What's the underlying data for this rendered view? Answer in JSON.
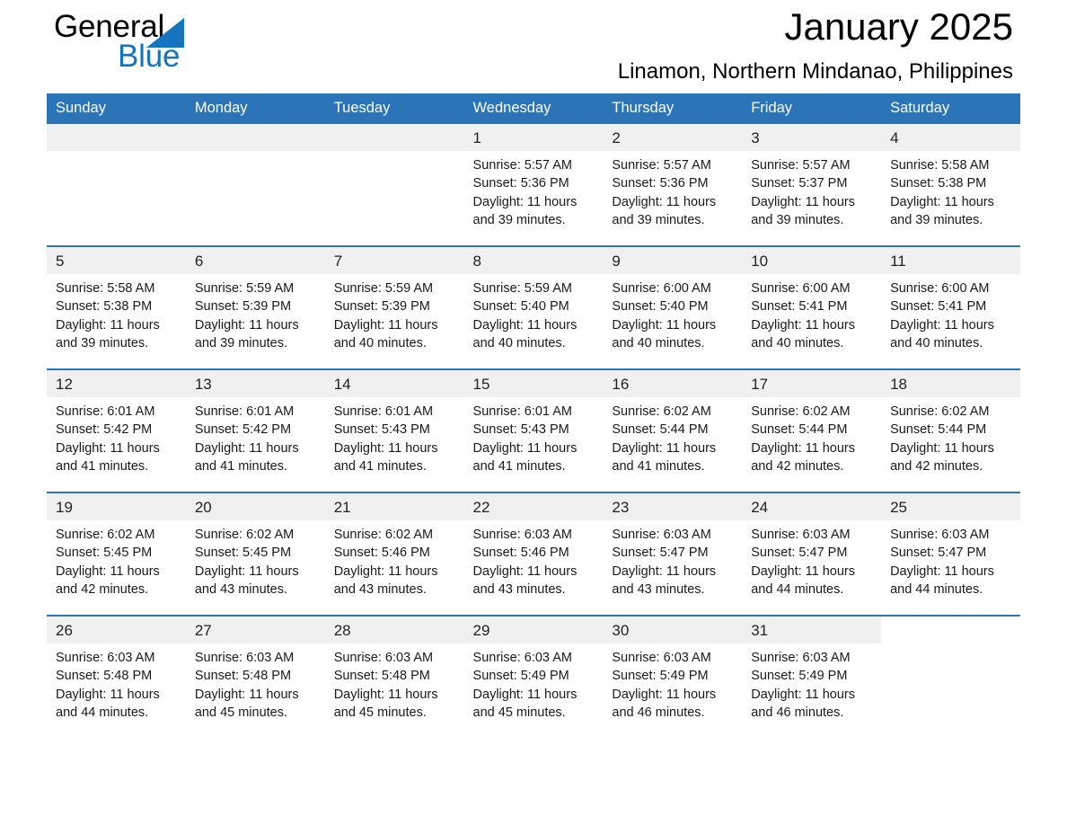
{
  "brand": {
    "word_one": "General",
    "word_two": "Blue",
    "accent_color": "#1574bd"
  },
  "header": {
    "title": "January 2025",
    "location": "Linamon, Northern Mindanao, Philippines",
    "header_bg": "#2b74b8",
    "daynum_bg": "#f0f0f0"
  },
  "weekday_headers": [
    "Sunday",
    "Monday",
    "Tuesday",
    "Wednesday",
    "Thursday",
    "Friday",
    "Saturday"
  ],
  "weeks": [
    [
      {
        "day": "",
        "sunrise": "",
        "sunset": "",
        "daylight_1": "",
        "daylight_2": "",
        "blank": true
      },
      {
        "day": "",
        "sunrise": "",
        "sunset": "",
        "daylight_1": "",
        "daylight_2": "",
        "blank": true
      },
      {
        "day": "",
        "sunrise": "",
        "sunset": "",
        "daylight_1": "",
        "daylight_2": "",
        "blank": true
      },
      {
        "day": "1",
        "sunrise": "Sunrise: 5:57 AM",
        "sunset": "Sunset: 5:36 PM",
        "daylight_1": "Daylight: 11 hours",
        "daylight_2": "and 39 minutes."
      },
      {
        "day": "2",
        "sunrise": "Sunrise: 5:57 AM",
        "sunset": "Sunset: 5:36 PM",
        "daylight_1": "Daylight: 11 hours",
        "daylight_2": "and 39 minutes."
      },
      {
        "day": "3",
        "sunrise": "Sunrise: 5:57 AM",
        "sunset": "Sunset: 5:37 PM",
        "daylight_1": "Daylight: 11 hours",
        "daylight_2": "and 39 minutes."
      },
      {
        "day": "4",
        "sunrise": "Sunrise: 5:58 AM",
        "sunset": "Sunset: 5:38 PM",
        "daylight_1": "Daylight: 11 hours",
        "daylight_2": "and 39 minutes."
      }
    ],
    [
      {
        "day": "5",
        "sunrise": "Sunrise: 5:58 AM",
        "sunset": "Sunset: 5:38 PM",
        "daylight_1": "Daylight: 11 hours",
        "daylight_2": "and 39 minutes."
      },
      {
        "day": "6",
        "sunrise": "Sunrise: 5:59 AM",
        "sunset": "Sunset: 5:39 PM",
        "daylight_1": "Daylight: 11 hours",
        "daylight_2": "and 39 minutes."
      },
      {
        "day": "7",
        "sunrise": "Sunrise: 5:59 AM",
        "sunset": "Sunset: 5:39 PM",
        "daylight_1": "Daylight: 11 hours",
        "daylight_2": "and 40 minutes."
      },
      {
        "day": "8",
        "sunrise": "Sunrise: 5:59 AM",
        "sunset": "Sunset: 5:40 PM",
        "daylight_1": "Daylight: 11 hours",
        "daylight_2": "and 40 minutes."
      },
      {
        "day": "9",
        "sunrise": "Sunrise: 6:00 AM",
        "sunset": "Sunset: 5:40 PM",
        "daylight_1": "Daylight: 11 hours",
        "daylight_2": "and 40 minutes."
      },
      {
        "day": "10",
        "sunrise": "Sunrise: 6:00 AM",
        "sunset": "Sunset: 5:41 PM",
        "daylight_1": "Daylight: 11 hours",
        "daylight_2": "and 40 minutes."
      },
      {
        "day": "11",
        "sunrise": "Sunrise: 6:00 AM",
        "sunset": "Sunset: 5:41 PM",
        "daylight_1": "Daylight: 11 hours",
        "daylight_2": "and 40 minutes."
      }
    ],
    [
      {
        "day": "12",
        "sunrise": "Sunrise: 6:01 AM",
        "sunset": "Sunset: 5:42 PM",
        "daylight_1": "Daylight: 11 hours",
        "daylight_2": "and 41 minutes."
      },
      {
        "day": "13",
        "sunrise": "Sunrise: 6:01 AM",
        "sunset": "Sunset: 5:42 PM",
        "daylight_1": "Daylight: 11 hours",
        "daylight_2": "and 41 minutes."
      },
      {
        "day": "14",
        "sunrise": "Sunrise: 6:01 AM",
        "sunset": "Sunset: 5:43 PM",
        "daylight_1": "Daylight: 11 hours",
        "daylight_2": "and 41 minutes."
      },
      {
        "day": "15",
        "sunrise": "Sunrise: 6:01 AM",
        "sunset": "Sunset: 5:43 PM",
        "daylight_1": "Daylight: 11 hours",
        "daylight_2": "and 41 minutes."
      },
      {
        "day": "16",
        "sunrise": "Sunrise: 6:02 AM",
        "sunset": "Sunset: 5:44 PM",
        "daylight_1": "Daylight: 11 hours",
        "daylight_2": "and 41 minutes."
      },
      {
        "day": "17",
        "sunrise": "Sunrise: 6:02 AM",
        "sunset": "Sunset: 5:44 PM",
        "daylight_1": "Daylight: 11 hours",
        "daylight_2": "and 42 minutes."
      },
      {
        "day": "18",
        "sunrise": "Sunrise: 6:02 AM",
        "sunset": "Sunset: 5:44 PM",
        "daylight_1": "Daylight: 11 hours",
        "daylight_2": "and 42 minutes."
      }
    ],
    [
      {
        "day": "19",
        "sunrise": "Sunrise: 6:02 AM",
        "sunset": "Sunset: 5:45 PM",
        "daylight_1": "Daylight: 11 hours",
        "daylight_2": "and 42 minutes."
      },
      {
        "day": "20",
        "sunrise": "Sunrise: 6:02 AM",
        "sunset": "Sunset: 5:45 PM",
        "daylight_1": "Daylight: 11 hours",
        "daylight_2": "and 43 minutes."
      },
      {
        "day": "21",
        "sunrise": "Sunrise: 6:02 AM",
        "sunset": "Sunset: 5:46 PM",
        "daylight_1": "Daylight: 11 hours",
        "daylight_2": "and 43 minutes."
      },
      {
        "day": "22",
        "sunrise": "Sunrise: 6:03 AM",
        "sunset": "Sunset: 5:46 PM",
        "daylight_1": "Daylight: 11 hours",
        "daylight_2": "and 43 minutes."
      },
      {
        "day": "23",
        "sunrise": "Sunrise: 6:03 AM",
        "sunset": "Sunset: 5:47 PM",
        "daylight_1": "Daylight: 11 hours",
        "daylight_2": "and 43 minutes."
      },
      {
        "day": "24",
        "sunrise": "Sunrise: 6:03 AM",
        "sunset": "Sunset: 5:47 PM",
        "daylight_1": "Daylight: 11 hours",
        "daylight_2": "and 44 minutes."
      },
      {
        "day": "25",
        "sunrise": "Sunrise: 6:03 AM",
        "sunset": "Sunset: 5:47 PM",
        "daylight_1": "Daylight: 11 hours",
        "daylight_2": "and 44 minutes."
      }
    ],
    [
      {
        "day": "26",
        "sunrise": "Sunrise: 6:03 AM",
        "sunset": "Sunset: 5:48 PM",
        "daylight_1": "Daylight: 11 hours",
        "daylight_2": "and 44 minutes."
      },
      {
        "day": "27",
        "sunrise": "Sunrise: 6:03 AM",
        "sunset": "Sunset: 5:48 PM",
        "daylight_1": "Daylight: 11 hours",
        "daylight_2": "and 45 minutes."
      },
      {
        "day": "28",
        "sunrise": "Sunrise: 6:03 AM",
        "sunset": "Sunset: 5:48 PM",
        "daylight_1": "Daylight: 11 hours",
        "daylight_2": "and 45 minutes."
      },
      {
        "day": "29",
        "sunrise": "Sunrise: 6:03 AM",
        "sunset": "Sunset: 5:49 PM",
        "daylight_1": "Daylight: 11 hours",
        "daylight_2": "and 45 minutes."
      },
      {
        "day": "30",
        "sunrise": "Sunrise: 6:03 AM",
        "sunset": "Sunset: 5:49 PM",
        "daylight_1": "Daylight: 11 hours",
        "daylight_2": "and 46 minutes."
      },
      {
        "day": "31",
        "sunrise": "Sunrise: 6:03 AM",
        "sunset": "Sunset: 5:49 PM",
        "daylight_1": "Daylight: 11 hours",
        "daylight_2": "and 46 minutes."
      },
      {
        "day": "",
        "sunrise": "",
        "sunset": "",
        "daylight_1": "",
        "daylight_2": "",
        "blank": true,
        "trailing": true
      }
    ]
  ]
}
